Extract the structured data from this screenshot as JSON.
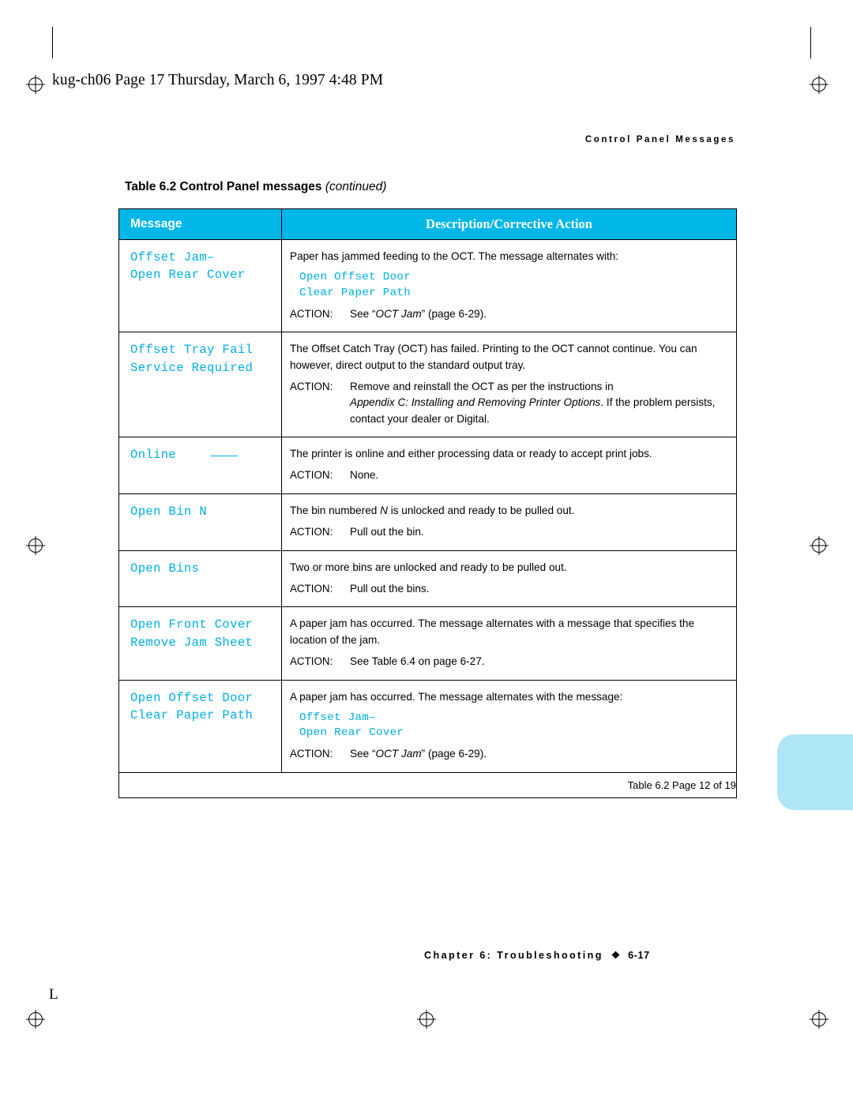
{
  "header_line": "kug-ch06  Page 17  Thursday, March 6, 1997  4:48 PM",
  "running_head": "Control Panel Messages",
  "table": {
    "caption_main": "Table 6.2    Control Panel messages ",
    "caption_cont": "(continued)",
    "columns": {
      "message": "Message",
      "description": "Description/Corrective Action"
    },
    "rows": [
      {
        "message_lines": [
          "Offset Jam–",
          "Open Rear Cover"
        ],
        "intro": "Paper has jammed feeding to the OCT. The message alternates with:",
        "alt_lines": [
          "Open Offset Door",
          "Clear Paper Path"
        ],
        "action_label": "ACTION:",
        "action_text_pre": "See “",
        "action_text_ital": "OCT Jam",
        "action_text_post": "” (page 6-29)."
      },
      {
        "message_lines": [
          "Offset Tray Fail",
          "Service Required"
        ],
        "intro": "The Offset Catch Tray (OCT) has failed. Printing to the OCT cannot continue. You can however, direct output to the standard output tray.",
        "action_label": "ACTION:",
        "action_text": "Remove and reinstall the OCT as per the instructions in",
        "action_ital": "Appendix C: Installing and Removing Printer Options",
        "action_cont": ". If the problem persists, contact your dealer or Digital."
      },
      {
        "message_lines": [
          "Online"
        ],
        "intro": "The printer is online and either processing data or ready to accept print jobs.",
        "action_label": "ACTION:",
        "action_text": "None."
      },
      {
        "message_lines": [
          "Open Bin N"
        ],
        "intro_pre": "The bin numbered ",
        "intro_ital": "N",
        "intro_post": " is unlocked and ready to be pulled out.",
        "action_label": "ACTION:",
        "action_text": "Pull out the bin."
      },
      {
        "message_lines": [
          "Open Bins"
        ],
        "intro": "Two or more bins are unlocked and ready to be pulled out.",
        "action_label": "ACTION:",
        "action_text": "Pull out the bins."
      },
      {
        "message_lines": [
          "Open Front Cover",
          "Remove Jam Sheet"
        ],
        "intro": "A paper jam has occurred. The message alternates with a message that specifies the location of the jam.",
        "action_label": "ACTION:",
        "action_text": "See Table 6.4 on page 6-27."
      },
      {
        "message_lines": [
          "Open Offset Door",
          "Clear Paper Path"
        ],
        "intro": "A paper jam has occurred. The message alternates with the message:",
        "alt_lines": [
          "Offset Jam–",
          "Open Rear Cover"
        ],
        "action_label": "ACTION:",
        "action_text_pre": "See “",
        "action_text_ital": "OCT Jam",
        "action_text_post": "” (page 6-29)."
      }
    ],
    "footer_note": "Table 6.2  Page 12 of 19"
  },
  "footer": {
    "chapter": "Chapter 6: Troubleshooting",
    "diamond": "❖",
    "page": "6-17"
  },
  "corner_mark": "L",
  "colors": {
    "header_band": "#00b7e8",
    "message_text": "#00aee4",
    "edge_tab": "#aee6f7"
  }
}
